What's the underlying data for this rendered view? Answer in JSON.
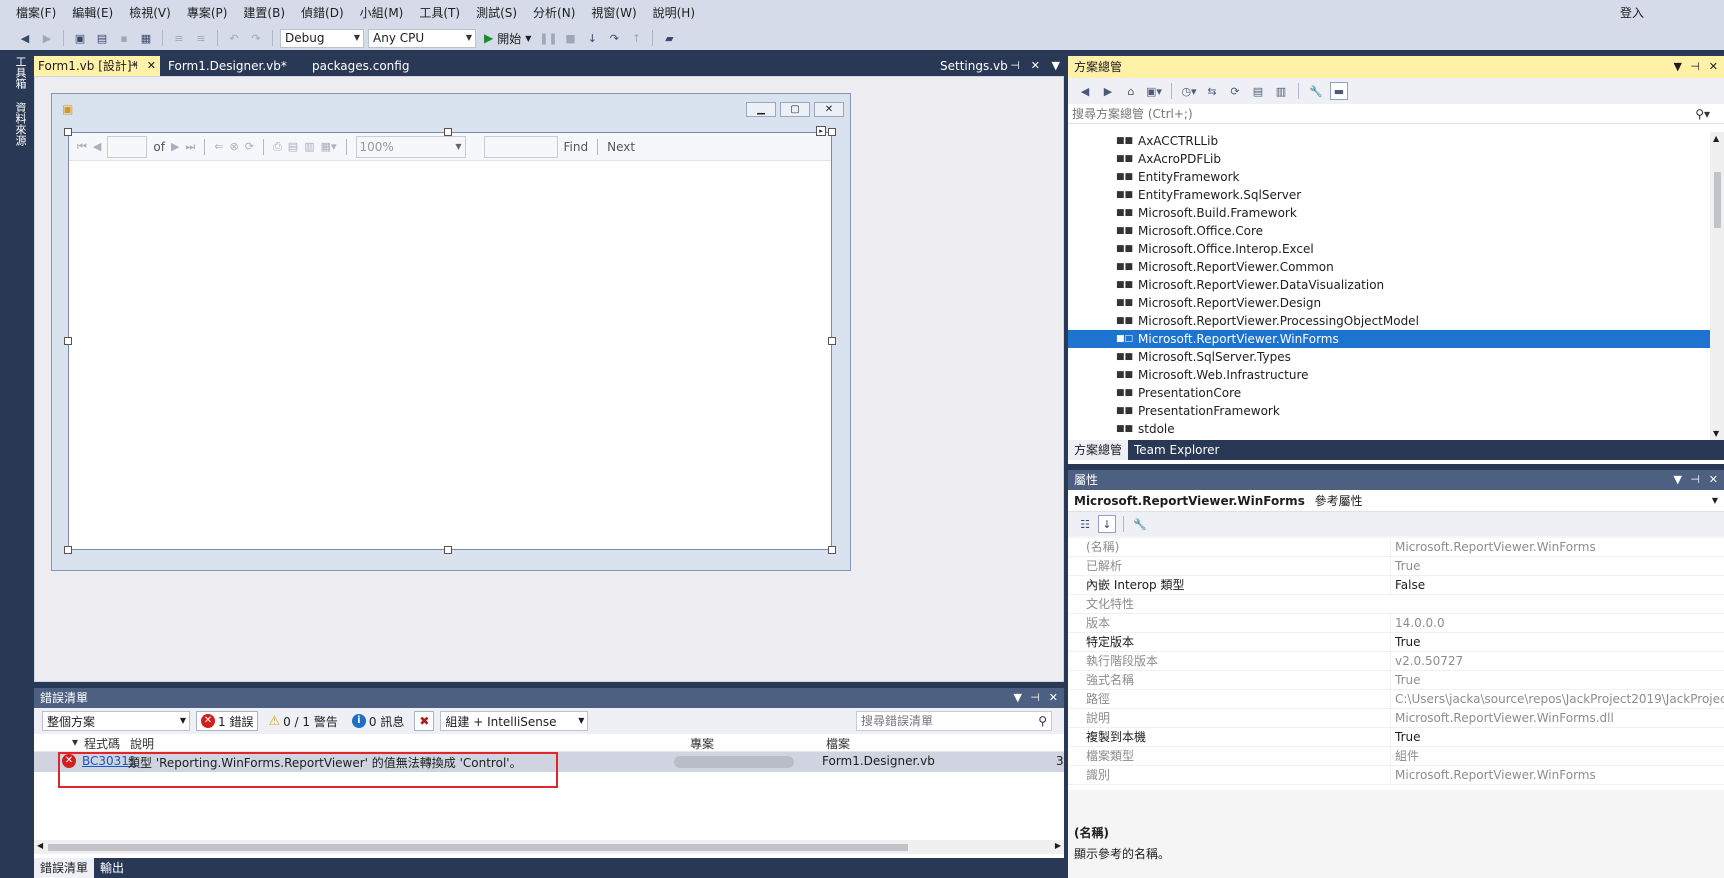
{
  "menu": {
    "items": [
      "檔案(F)",
      "編輯(E)",
      "檢視(V)",
      "專案(P)",
      "建置(B)",
      "偵錯(D)",
      "小組(M)",
      "工具(T)",
      "測試(S)",
      "分析(N)",
      "視窗(W)",
      "說明(H)"
    ],
    "login": "登入"
  },
  "toolbar": {
    "config": "Debug",
    "platform": "Any CPU",
    "start_label": "開始"
  },
  "side_tabs": {
    "toolbox": "工具箱",
    "datasources": "資料來源"
  },
  "doc_tabs": [
    {
      "label": "Form1.vb [設計]*",
      "active": true
    },
    {
      "label": "Form1.Designer.vb*",
      "active": false
    },
    {
      "label": "packages.config",
      "active": false
    }
  ],
  "doc_tab_right": "Settings.vb",
  "report_viewer": {
    "of_label": "of",
    "zoom": "100%",
    "find_label": "Find",
    "next_label": "Next"
  },
  "error_list": {
    "title": "錯誤清單",
    "scope": "整個方案",
    "errors_btn": "1 錯誤",
    "warnings_btn": "0 / 1 警告",
    "messages_btn": "0 訊息",
    "build_filter": "組建 + IntelliSense",
    "search_placeholder": "搜尋錯誤清單",
    "columns": {
      "code": "程式碼",
      "desc": "說明",
      "project": "專案",
      "file": "檔案",
      "line": "3"
    },
    "rows": [
      {
        "code": "BC30311",
        "desc": "類型 'Reporting.WinForms.ReportViewer' 的值無法轉換成 'Control'。",
        "file": "Form1.Designer.vb",
        "line": "3"
      }
    ],
    "bottom_tabs": [
      "錯誤清單",
      "輸出"
    ]
  },
  "solution_explorer": {
    "title": "方案總管",
    "search_placeholder": "搜尋方案總管 (Ctrl+;)",
    "items": [
      "AxACCTRLLib",
      "AxAcroPDFLib",
      "EntityFramework",
      "EntityFramework.SqlServer",
      "Microsoft.Build.Framework",
      "Microsoft.Office.Core",
      "Microsoft.Office.Interop.Excel",
      "Microsoft.ReportViewer.Common",
      "Microsoft.ReportViewer.DataVisualization",
      "Microsoft.ReportViewer.Design",
      "Microsoft.ReportViewer.ProcessingObjectModel",
      "Microsoft.ReportViewer.WinForms",
      "Microsoft.SqlServer.Types",
      "Microsoft.Web.Infrastructure",
      "PresentationCore",
      "PresentationFramework",
      "stdole"
    ],
    "selected": "Microsoft.ReportViewer.WinForms",
    "bottom_tabs": [
      "方案總管",
      "Team Explorer"
    ]
  },
  "properties": {
    "title": "屬性",
    "object_name": "Microsoft.ReportViewer.WinForms",
    "object_type": "參考屬性",
    "rows": [
      {
        "name": "(名稱)",
        "value": "Microsoft.ReportViewer.WinForms",
        "readonly": true
      },
      {
        "name": "已解析",
        "value": "True",
        "readonly": true
      },
      {
        "name": "內嵌 Interop 類型",
        "value": "False",
        "readonly": false
      },
      {
        "name": "文化特性",
        "value": "",
        "readonly": true
      },
      {
        "name": "版本",
        "value": "14.0.0.0",
        "readonly": true
      },
      {
        "name": "特定版本",
        "value": "True",
        "readonly": false
      },
      {
        "name": "執行階段版本",
        "value": "v2.0.50727",
        "readonly": true
      },
      {
        "name": "強式名稱",
        "value": "True",
        "readonly": true
      },
      {
        "name": "路徑",
        "value": "C:\\Users\\jacka\\source\\repos\\JackProject2019\\JackProject20",
        "readonly": true
      },
      {
        "name": "說明",
        "value": "Microsoft.ReportViewer.WinForms.dll",
        "readonly": true
      },
      {
        "name": "複製到本機",
        "value": "True",
        "readonly": false
      },
      {
        "name": "檔案類型",
        "value": "組件",
        "readonly": true
      },
      {
        "name": "識別",
        "value": "Microsoft.ReportViewer.WinForms",
        "readonly": true
      }
    ],
    "desc_title": "(名稱)",
    "desc_text": "顯示參考的名稱。"
  }
}
